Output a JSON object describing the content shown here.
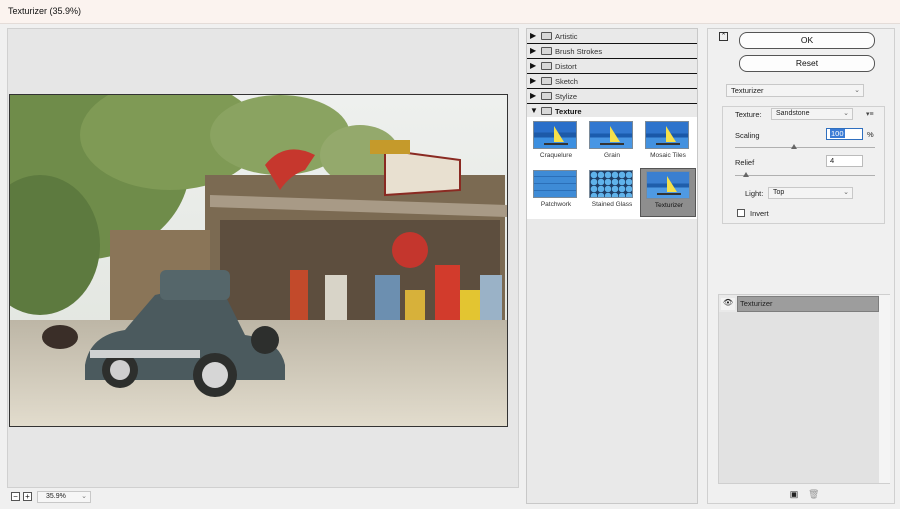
{
  "window": {
    "title": "Texturizer (35.9%)"
  },
  "preview": {
    "zoom_value": "35.9%",
    "zoom_out": "−",
    "zoom_in": "+"
  },
  "gallery": {
    "categories": [
      {
        "label": "Artistic",
        "open": false
      },
      {
        "label": "Brush Strokes",
        "open": false
      },
      {
        "label": "Distort",
        "open": false
      },
      {
        "label": "Sketch",
        "open": false
      },
      {
        "label": "Stylize",
        "open": false
      },
      {
        "label": "Texture",
        "open": true
      }
    ],
    "thumbnails": [
      {
        "label": "Craquelure",
        "selected": false
      },
      {
        "label": "Grain",
        "selected": false
      },
      {
        "label": "Mosaic Tiles",
        "selected": false
      },
      {
        "label": "Patchwork",
        "selected": false
      },
      {
        "label": "Stained Glass",
        "selected": false
      },
      {
        "label": "Texturizer",
        "selected": true
      }
    ]
  },
  "controls": {
    "ok_label": "OK",
    "reset_label": "Reset",
    "filter_select": "Texturizer",
    "texture_label": "Texture:",
    "texture_value": "Sandstone",
    "scaling_label": "Scaling",
    "scaling_value": "100",
    "scaling_unit": "%",
    "scaling_slider_fraction": 0.42,
    "relief_label": "Relief",
    "relief_value": "4",
    "relief_slider_fraction": 0.08,
    "light_label": "Light:",
    "light_value": "Top",
    "invert_label": "Invert",
    "invert_checked": false
  },
  "layers": {
    "items": [
      {
        "name": "Texturizer",
        "visible": true
      }
    ]
  },
  "colors": {
    "selected_thumb": "#8e8e8e",
    "focus_input": "#2f6fbf",
    "layer_selected": "#9d9d9d"
  },
  "icons": [
    "collapse-icon",
    "folder-icon",
    "eye-icon",
    "new-layer-icon",
    "delete-layer-icon",
    "panel-menu-icon"
  ]
}
